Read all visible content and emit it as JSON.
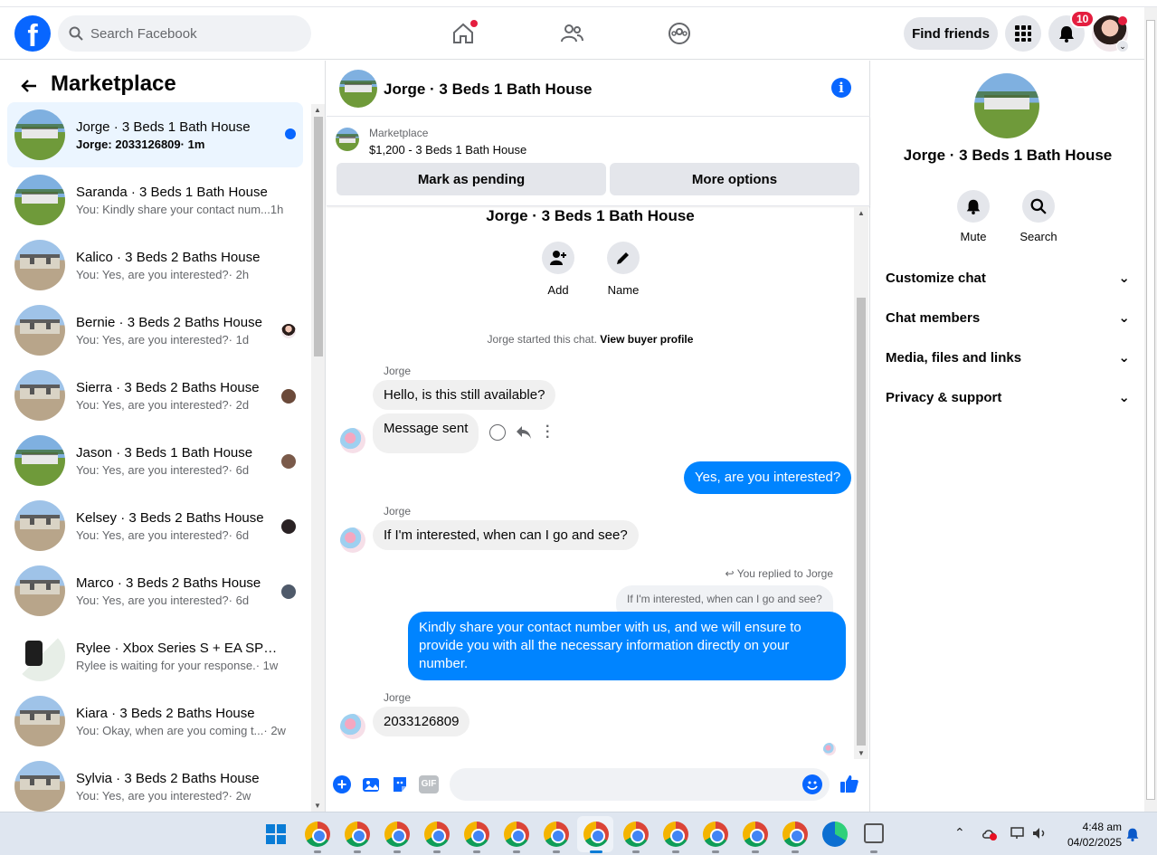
{
  "header": {
    "search_placeholder": "Search Facebook",
    "find_friends": "Find friends",
    "notification_count": "10"
  },
  "left": {
    "title": "Marketplace",
    "conversations": [
      {
        "name": "Jorge · 3 Beds 1 Bath House",
        "preview": "Jorge: 2033126809",
        "time": "· 1m",
        "active": true
      },
      {
        "name": "Saranda · 3 Beds 1 Bath House",
        "preview": "You: Kindly share your contact num...",
        "time": " 1h"
      },
      {
        "name": "Kalico · 3 Beds 2 Baths House",
        "preview": "You: Yes, are you interested?",
        "time": " · 2h"
      },
      {
        "name": "Bernie · 3 Beds 2 Baths House",
        "preview": "You: Yes, are you interested?",
        "time": " · 1d"
      },
      {
        "name": "Sierra · 3 Beds 2 Baths House",
        "preview": "You: Yes, are you interested?",
        "time": " · 2d"
      },
      {
        "name": "Jason · 3 Beds 1 Bath House",
        "preview": "You: Yes, are you interested?",
        "time": " · 6d"
      },
      {
        "name": "Kelsey · 3 Beds 2 Baths House",
        "preview": "You: Yes, are you interested?",
        "time": " · 6d"
      },
      {
        "name": "Marco · 3 Beds 2 Baths House",
        "preview": "You: Yes, are you interested?",
        "time": " · 6d"
      },
      {
        "name": "Rylee · Xbox Series S + EA SPOR...",
        "preview": "Rylee is waiting for your response.",
        "time": " · 1w"
      },
      {
        "name": "Kiara · 3 Beds 2 Baths House",
        "preview": "You: Okay, when are you coming t...",
        "time": " · 2w"
      },
      {
        "name": "Sylvia · 3 Beds 2 Baths House",
        "preview": "You: Yes, are you interested?",
        "time": " · 2w"
      }
    ]
  },
  "chat": {
    "title": "Jorge · 3 Beds 1 Bath House",
    "listing_label": "Marketplace",
    "listing_price": "$1,200 - 3 Beds 1 Bath House",
    "mark_pending": "Mark as pending",
    "more_options": "More options",
    "intro_title": "Jorge · 3 Beds 1 Bath House",
    "add_label": "Add",
    "name_label": "Name",
    "started": "Jorge started this chat.",
    "view_profile": "View buyer profile",
    "sender": "Jorge",
    "msg1": "Hello, is this still available?",
    "msg2": "Message sent",
    "msg3": "Yes, are you interested?",
    "msg4": "If I'm interested, when can I go and see?",
    "replied_to": "You replied to Jorge",
    "quoted": "If I'm interested, when can I go and see?",
    "msg5": "Kindly share your contact number with us, and we will ensure to provide you with all the necessary information directly on your number.",
    "msg6": "2033126809",
    "gif_label": "GIF"
  },
  "right": {
    "name": "Jorge · 3 Beds 1 Bath House",
    "mute": "Mute",
    "search": "Search",
    "rows": [
      "Customize chat",
      "Chat members",
      "Media, files and links",
      "Privacy & support"
    ]
  },
  "taskbar": {
    "time": "4:48 am",
    "date": "04/02/2025"
  },
  "colors": {
    "accent": "#0866ff",
    "outgoing": "#0084ff",
    "badge": "#e41e3f"
  }
}
